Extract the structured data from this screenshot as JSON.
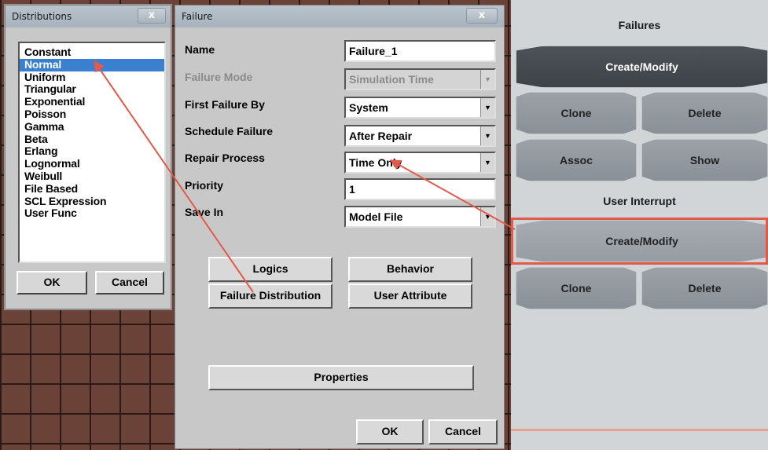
{
  "distributions_window": {
    "title": "Distributions",
    "close_label": "x",
    "items": [
      "Constant",
      "Normal",
      "Uniform",
      "Triangular",
      "Exponential",
      "Poisson",
      "Gamma",
      "Beta",
      "Erlang",
      "Lognormal",
      "Weibull",
      "File Based",
      "SCL Expression",
      "User Func"
    ],
    "selected": "Normal",
    "ok_label": "OK",
    "cancel_label": "Cancel"
  },
  "failure_window": {
    "title": "Failure",
    "close_label": "x",
    "fields": {
      "name": {
        "label": "Name",
        "value": "Failure_1"
      },
      "failure_mode": {
        "label": "Failure Mode",
        "value": "Simulation Time"
      },
      "first_failure_by": {
        "label": "First Failure By",
        "value": "System"
      },
      "schedule_failure": {
        "label": "Schedule Failure",
        "value": "After Repair"
      },
      "repair_process": {
        "label": "Repair Process",
        "value": "Time Only"
      },
      "priority": {
        "label": "Priority",
        "value": "1"
      },
      "save_in": {
        "label": "Save In",
        "value": "Model File"
      }
    },
    "buttons": {
      "logics": "Logics",
      "behavior": "Behavior",
      "failure_distribution": "Failure Distribution",
      "user_attribute": "User Attribute",
      "properties": "Properties",
      "ok": "OK",
      "cancel": "Cancel"
    }
  },
  "right_panel": {
    "failures_header": "Failures",
    "create_modify_1": "Create/Modify",
    "clone_1": "Clone",
    "delete_1": "Delete",
    "assoc": "Assoc",
    "show": "Show",
    "user_interrupt_header": "User Interrupt",
    "create_modify_2": "Create/Modify",
    "clone_2": "Clone",
    "delete_2": "Delete"
  },
  "colors": {
    "annotation_red": "#e25a4a",
    "selection_blue": "#3a7fd0"
  }
}
